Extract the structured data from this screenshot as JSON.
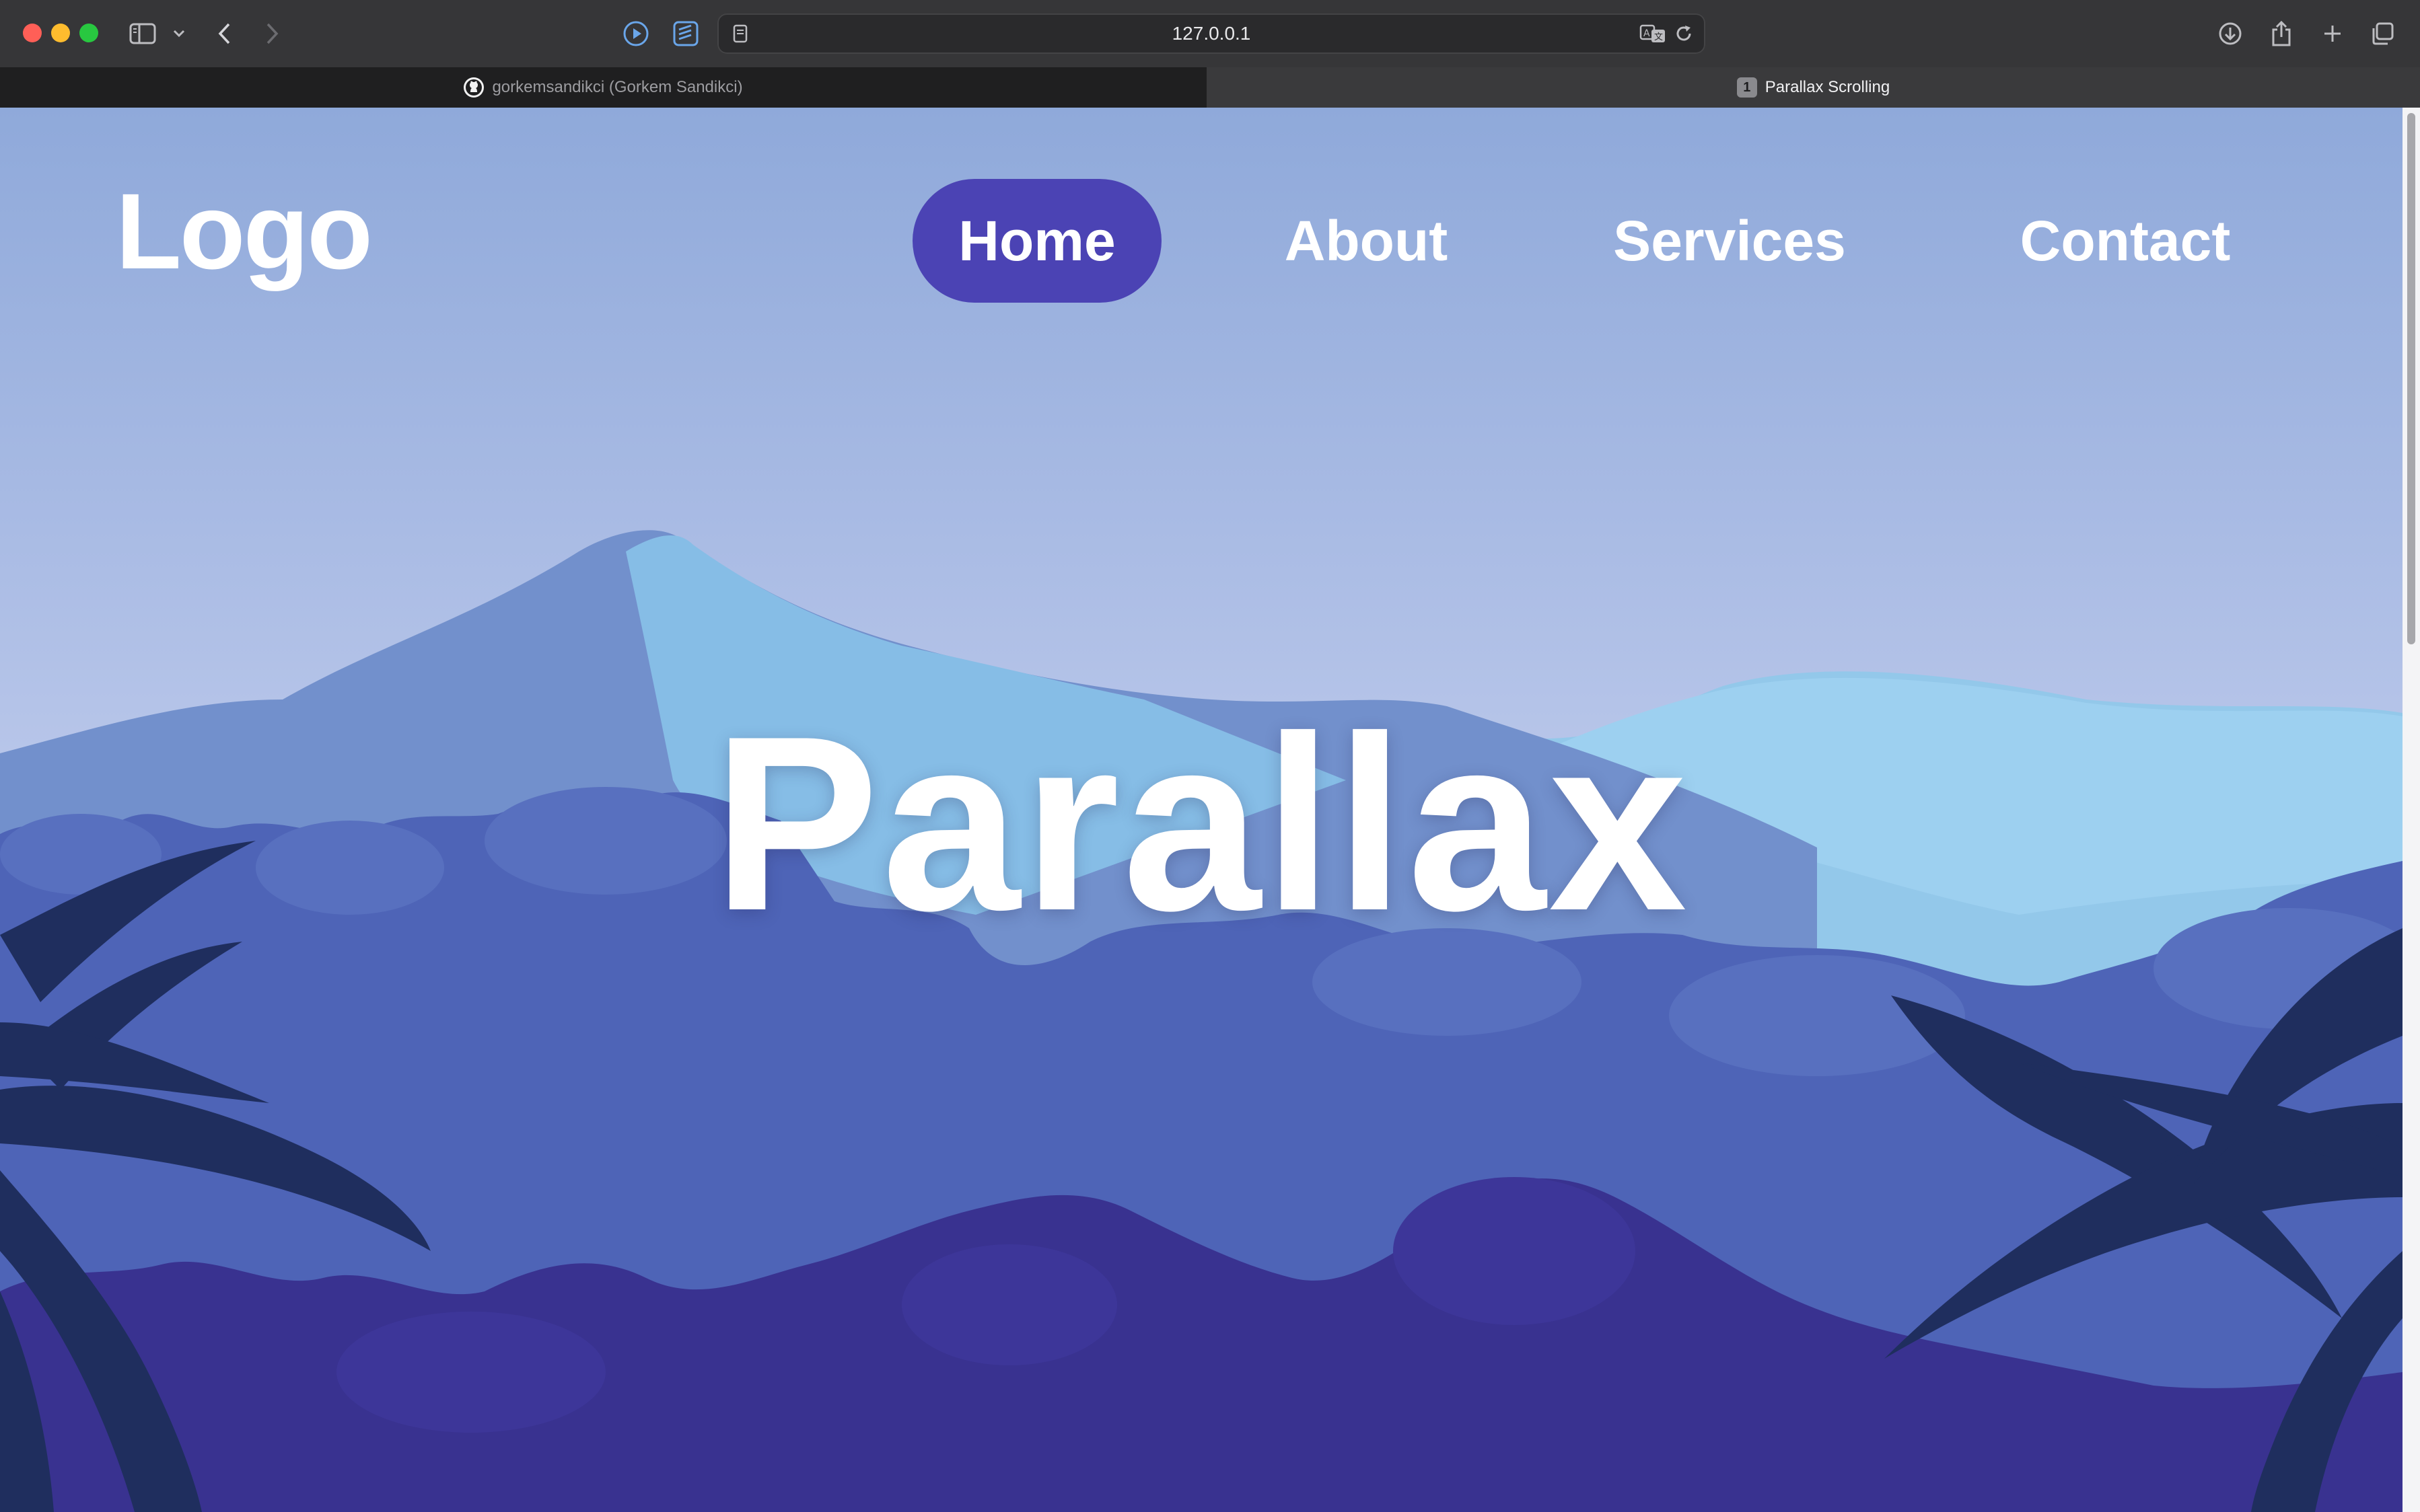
{
  "browser": {
    "url": "127.0.0.1",
    "tabs": [
      {
        "title": "gorkemsandikci (Gorkem Sandikci)",
        "active": false,
        "favicon": "github-icon"
      },
      {
        "title": "Parallax Scrolling",
        "active": true,
        "favicon_text": "1"
      }
    ],
    "icons": [
      "sidebar-icon",
      "chevron-down-icon",
      "back-icon",
      "forward-icon",
      "play-icon",
      "reader-icon",
      "page-icon",
      "translate-icon",
      "reload-icon",
      "download-icon",
      "share-icon",
      "new-tab-icon",
      "tab-overview-icon"
    ]
  },
  "page": {
    "logo": "Logo",
    "nav": {
      "home": "Home",
      "about": "About",
      "services": "Services",
      "contact": "Contact",
      "active": "Home"
    },
    "hero_title": "Parallax",
    "colors": {
      "nav_active_bg": "#4b43b4",
      "sky": "#a9bbe4",
      "foreground": "#393290"
    }
  }
}
